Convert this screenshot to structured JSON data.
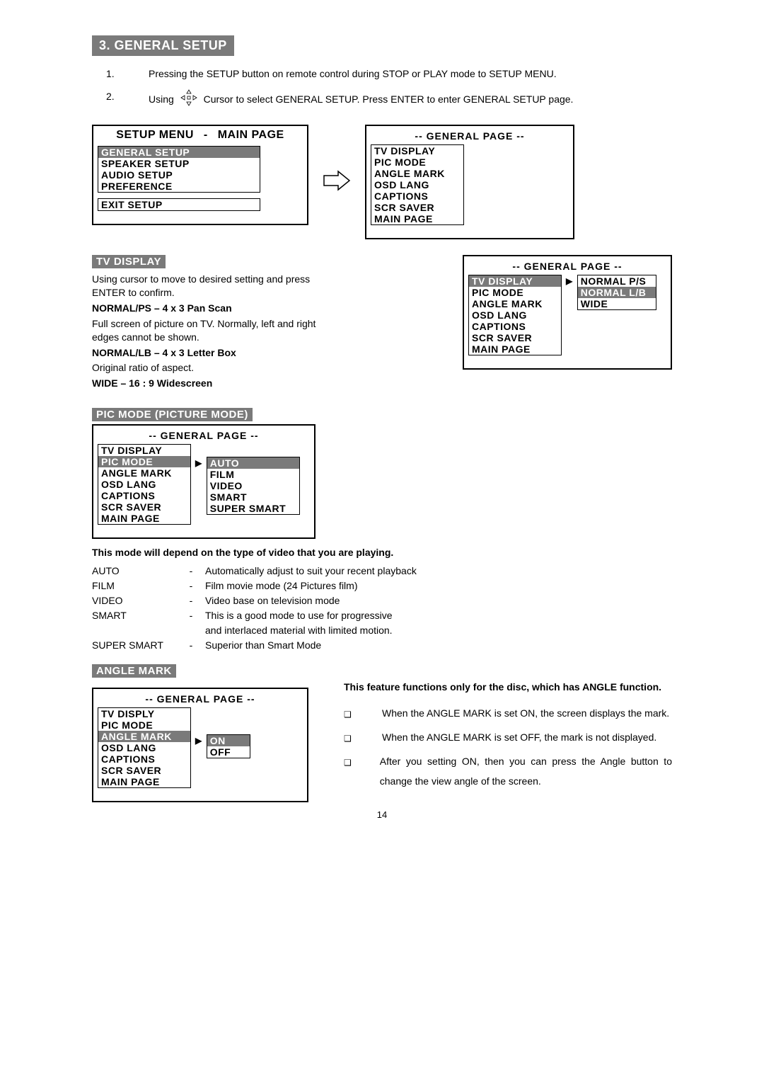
{
  "header": {
    "title": "3.  GENERAL SETUP"
  },
  "intro": {
    "items": [
      {
        "num": "1.",
        "text": "Pressing the SETUP button on remote control during STOP or PLAY mode to SETUP MENU."
      },
      {
        "num": "2.",
        "text_before": "Using",
        "text_after": "Cursor to select GENERAL SETUP. Press ENTER to enter GENERAL SETUP page."
      }
    ]
  },
  "setup_menu": {
    "title_left": "SETUP MENU",
    "title_dash": "-",
    "title_right": "MAIN PAGE",
    "items": [
      "GENERAL SETUP",
      "SPEAKER SETUP",
      "AUDIO SETUP",
      "PREFERENCE"
    ],
    "exit": "EXIT SETUP",
    "selected_index": 0
  },
  "general_page_1": {
    "title": "-- GENERAL PAGE --",
    "items": [
      "TV DISPLAY",
      "PIC MODE",
      "ANGLE MARK",
      "OSD LANG",
      "CAPTIONS",
      "SCR SAVER",
      "MAIN PAGE"
    ]
  },
  "tv_display": {
    "heading": "TV DISPLAY",
    "p1": "Using  cursor to move to desired setting and press ENTER to confirm.",
    "opt1_b": "NORMAL/PS – 4 x 3 Pan Scan",
    "opt1_t": "Full screen of picture on TV. Normally, left and right edges cannot be shown.",
    "opt2_b": "NORMAL/LB – 4 x 3 Letter Box",
    "opt2_t": "Original ratio of aspect.",
    "opt3_b": "WIDE – 16 : 9 Widescreen",
    "submenu": {
      "title": "-- GENERAL PAGE --",
      "left": [
        "TV DISPLAY",
        "PIC MODE",
        "ANGLE MARK",
        "OSD LANG",
        "CAPTIONS",
        "SCR SAVER",
        "MAIN PAGE"
      ],
      "left_sel": 0,
      "right": [
        "NORMAL P/S",
        "NORMAL L/B",
        "WIDE"
      ],
      "right_sel": 1
    }
  },
  "pic_mode": {
    "heading": "PIC MODE (PICTURE MODE)",
    "menu": {
      "title": "-- GENERAL PAGE --",
      "left": [
        "TV DISPLAY",
        "PIC MODE",
        "ANGLE MARK",
        "OSD LANG",
        "CAPTIONS",
        "SCR SAVER",
        "MAIN PAGE"
      ],
      "left_sel": 1,
      "right": [
        "AUTO",
        "FILM",
        "VIDEO",
        "SMART",
        "SUPER SMART"
      ],
      "right_sel": 0
    },
    "lead": "This mode will depend on the type of video that you are playing.",
    "rows": [
      {
        "name": "AUTO",
        "desc": "Automatically adjust to suit your recent playback"
      },
      {
        "name": "FILM",
        "desc": "Film movie mode (24 Pictures film)"
      },
      {
        "name": "VIDEO",
        "desc": "Video base on television mode"
      },
      {
        "name": "SMART",
        "desc": "This is a good mode to use for progressive"
      },
      {
        "name": "",
        "desc": "and interlaced material with limited motion."
      },
      {
        "name": "SUPER SMART",
        "desc": "Superior than Smart Mode"
      }
    ]
  },
  "angle_mark": {
    "heading": "ANGLE MARK",
    "menu": {
      "title": "-- GENERAL PAGE --",
      "left": [
        "TV DISPLY",
        "PIC MODE",
        "ANGLE MARK",
        "OSD LANG",
        "CAPTIONS",
        "SCR SAVER",
        "MAIN PAGE"
      ],
      "left_sel": 2,
      "right": [
        "ON",
        "OFF"
      ],
      "right_sel": 0
    },
    "lead": "This feature functions only for the disc, which has ANGLE function.",
    "bullets": [
      "When the ANGLE MARK is set ON, the screen displays the mark.",
      "When the ANGLE MARK is set OFF, the mark is not displayed.",
      "After you setting ON, then you can press the Angle button to change the view angle of the screen."
    ]
  },
  "page_num": "14"
}
